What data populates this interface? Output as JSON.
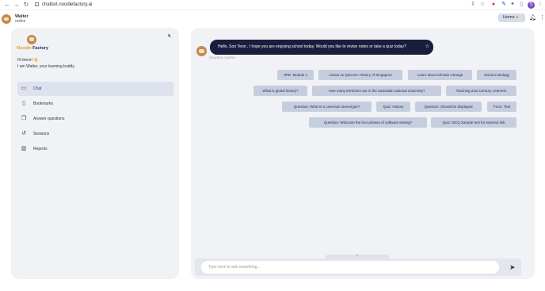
{
  "browser": {
    "url": "chatbot.noodlefactory.ai",
    "profile_initial": "S"
  },
  "header": {
    "app_name": "Walter",
    "status": "online",
    "home_label": "Home"
  },
  "sidebar": {
    "brand_part1": "Noodle",
    "brand_part2": "Factory",
    "greeting_line1": "Hi there! 👋",
    "greeting_line2": "I am Walter, your learning buddy.",
    "items": [
      {
        "label": "Chat",
        "icon": "chat-icon"
      },
      {
        "label": "Bookmarks",
        "icon": "bookmark-icon"
      },
      {
        "label": "Answer questions",
        "icon": "quiz-icon"
      },
      {
        "label": "Sessions",
        "icon": "history-icon"
      },
      {
        "label": "Reports",
        "icon": "chart-icon"
      }
    ]
  },
  "chat": {
    "message": "Hello, Soo Yeon , I hope you are enjoying school today. Would you like to revise notes or take a quiz today?",
    "timestamp": "22/11/2023, 2:48 PM",
    "suggestions": [
      "HPE: Module 1",
      "Lesson & Quizzes: History of Singapore",
      "Learn about Climate Change",
      "Science Biology",
      "What is global history?",
      "How many territories are in the australian national university?",
      "Teaching 21st Century Learners",
      "Question: What is a caveman stereotype?",
      "Quiz: History",
      "Question: Should be displayed",
      "Form: Test",
      "Question: What are the four phases of software testing?",
      "Quiz: MCQ Sample test for external link"
    ],
    "input_placeholder": "Type here to ask something..."
  },
  "colors": {
    "bubble_bg": "#1a1e3d",
    "chip_bg": "#c6cedd",
    "active_nav_bg": "#dde2ee",
    "brand_orange": "#e5a02a"
  }
}
